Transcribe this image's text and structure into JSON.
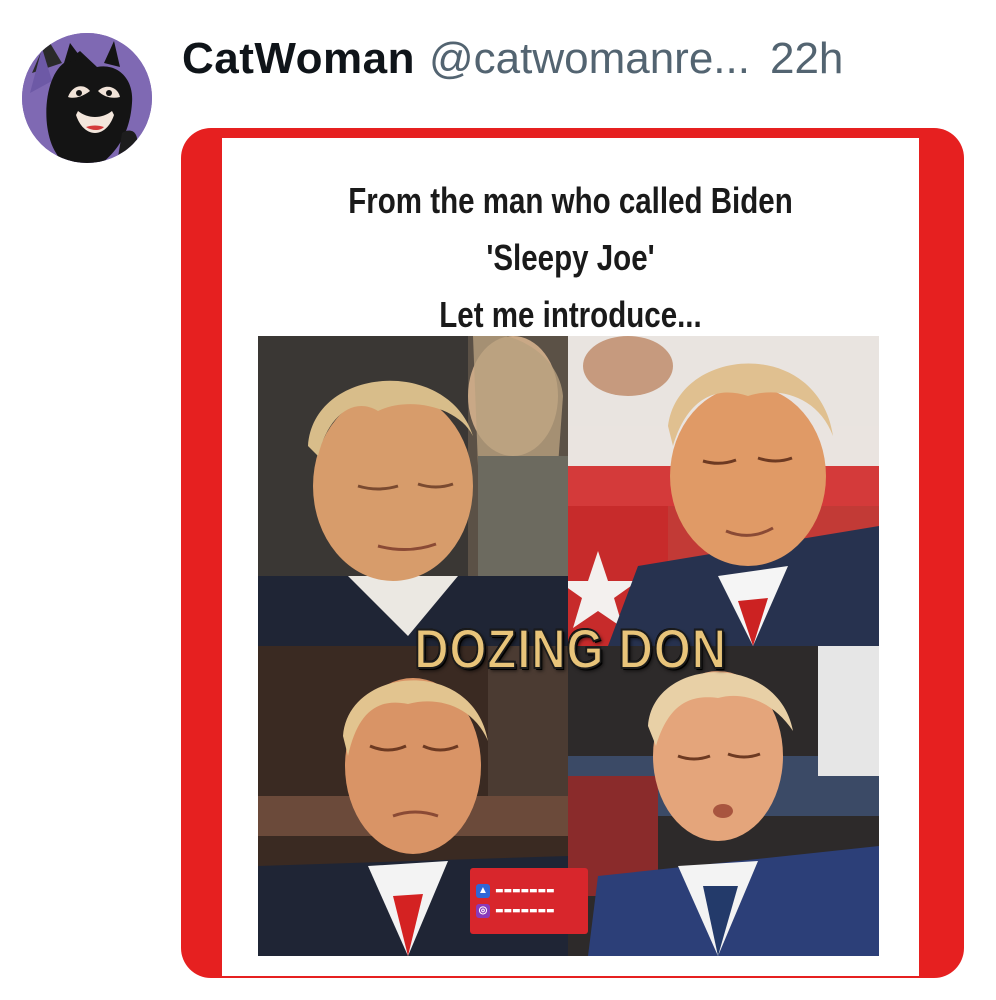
{
  "post": {
    "display_name": "CatWoman",
    "handle": "@catwomanre...",
    "time": "22h"
  },
  "avatar": {
    "icon": "catwoman-avatar",
    "background": "#7f69b3"
  },
  "media": {
    "border_color": "#e62020",
    "caption": {
      "line1": "From the man who called Biden",
      "line2": "'Sleepy Joe'",
      "line3": "Let me introduce..."
    },
    "overlay_title": "DOZING DON",
    "overlay_color": "#e8c47a"
  }
}
